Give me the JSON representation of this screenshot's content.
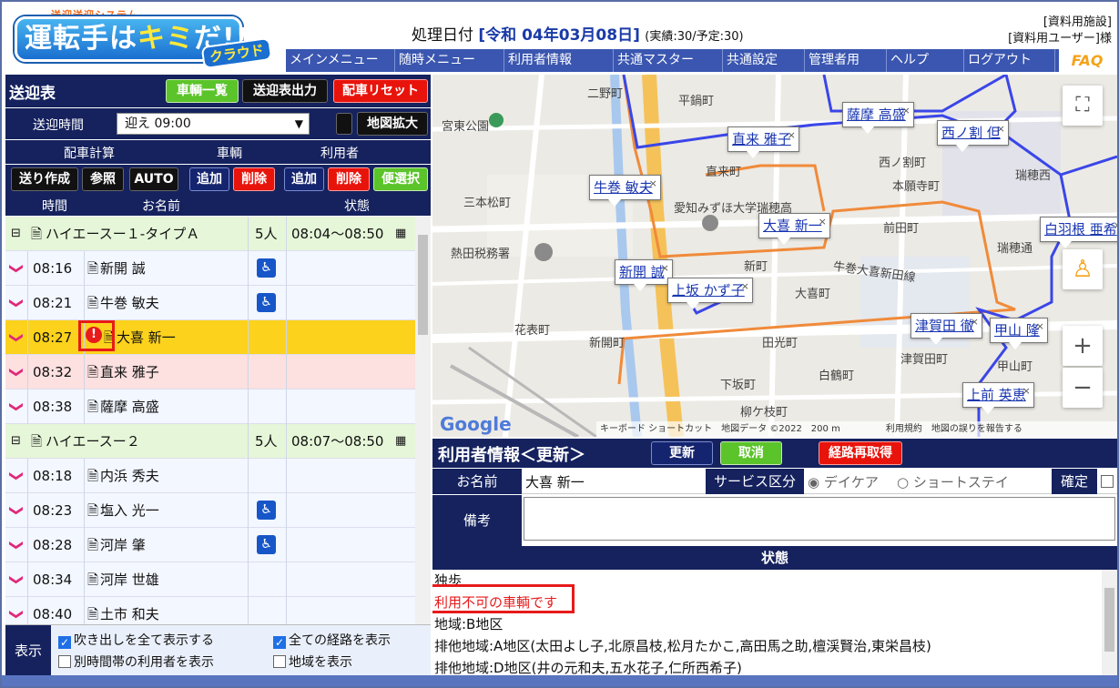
{
  "header": {
    "logo_small": "送迎送迎システム",
    "logo_main_a": "運転手は",
    "logo_main_b": "キミ",
    "logo_main_c": "だ!!",
    "logo_sub": "クラウド",
    "proc_label": "処理日付",
    "proc_date": "[令和 04年03月08日]",
    "proc_counts": "(実績:30/予定:30)",
    "facility": "[資料用施設]",
    "user": "[資料用ユーザー]様"
  },
  "menu": [
    "メインメニュー",
    "随時メニュー",
    "利用者情報",
    "共通マスター",
    "共通設定",
    "管理者用",
    "ヘルプ",
    "ログアウト"
  ],
  "faq": "FAQ",
  "left": {
    "title": "送迎表",
    "btn_vehicle_list": "車輌一覧",
    "btn_output": "送迎表出力",
    "btn_reset": "配車リセット",
    "time_label": "送迎時間",
    "time_value": "迎え 09:00",
    "btn_map_expand": "地図拡大",
    "calc_heads": {
      "calc": "配車計算",
      "vehicle": "車輌",
      "user": "利用者"
    },
    "btn_create": "送り作成",
    "btn_ref": "参照",
    "btn_auto": "AUTO",
    "btn_v_add": "追加",
    "btn_v_del": "削除",
    "btn_u_add": "追加",
    "btn_u_del": "削除",
    "btn_convenient": "便選択",
    "col_time": "時間",
    "col_name": "お名前",
    "col_status": "状態"
  },
  "rows": [
    {
      "type": "group",
      "name": "ハイエースー１-タイプＡ",
      "count": "5人",
      "range": "08:04〜08:50"
    },
    {
      "type": "item",
      "time": "08:16",
      "name": "新開 誠",
      "wheel": true
    },
    {
      "type": "item",
      "time": "08:21",
      "name": "牛巻 敏夫",
      "wheel": true
    },
    {
      "type": "item",
      "time": "08:27",
      "name": "大喜 新一",
      "warn": true,
      "sel": true
    },
    {
      "type": "item",
      "time": "08:32",
      "name": "直来 雅子",
      "pink": true
    },
    {
      "type": "item",
      "time": "08:38",
      "name": "薩摩 高盛"
    },
    {
      "type": "group",
      "name": "ハイエースー２",
      "count": "5人",
      "range": "08:07〜08:50"
    },
    {
      "type": "item",
      "time": "08:18",
      "name": "内浜 秀夫"
    },
    {
      "type": "item",
      "time": "08:23",
      "name": "塩入 光一",
      "wheel": true
    },
    {
      "type": "item",
      "time": "08:28",
      "name": "河岸 肇",
      "wheel": true
    },
    {
      "type": "item",
      "time": "08:34",
      "name": "河岸 世雄"
    },
    {
      "type": "item",
      "time": "08:40",
      "name": "土市 和夫"
    }
  ],
  "display": {
    "label": "表示",
    "opt1": "吹き出しを全て表示する",
    "opt2": "全ての経路を表示",
    "opt3": "別時間帯の利用者を表示",
    "opt4": "地域を表示"
  },
  "map": {
    "bubbles": [
      "牛巻 敏夫",
      "直来 雅子",
      "薩摩 高盛",
      "西ノ割 但",
      "大喜 新一",
      "新開 誠",
      "上坂 かず子",
      "白羽根 亜希",
      "津賀田 徹",
      "甲山 隆",
      "上前 英恵"
    ],
    "places": [
      "二野町",
      "平鍋町",
      "宮東公園",
      "直来町",
      "西ノ割町",
      "本願寺町",
      "三本松町",
      "愛知みずほ大学瑞穂高",
      "前田町",
      "熱田税務署",
      "新町",
      "牛巻大喜新田線",
      "大喜町",
      "花表町",
      "新開町",
      "田光町",
      "津賀田町",
      "甲山町",
      "白鶴町",
      "下坂町",
      "柳ケ枝町",
      "瑞穂通",
      "瑞穂西"
    ],
    "google": "Google",
    "footer": "キーボード ショートカット　地図データ ©2022　200 m　　　　　利用規約　地図の誤りを報告する"
  },
  "info": {
    "title": "利用者情報＜更新＞",
    "btn_update": "更新",
    "btn_cancel": "取消",
    "btn_reroute": "経路再取得",
    "name_label": "お名前",
    "name_value": "大喜 新一",
    "service_label": "サービス区分",
    "service_opt1": "デイケア",
    "service_opt2": "ショートステイ",
    "confirm_label": "確定",
    "remarks_label": "備考",
    "status_head": "状態",
    "status_lines": [
      "独歩",
      "利用不可の車輌です",
      "地域:B地区",
      "排他地域:A地区(太田よし子,北原昌枝,松月たかこ,高田馬之助,檀渓賢治,東栄昌枝)",
      "排他地域:D地区(井の元和夫,五水花子,仁所西希子)"
    ]
  },
  "colors": {
    "navy": "#15225e",
    "menu": "#3a56b0",
    "accent_red": "#e81a1a",
    "accent_green": "#5bc42a",
    "highlight": "#fcd21c"
  }
}
